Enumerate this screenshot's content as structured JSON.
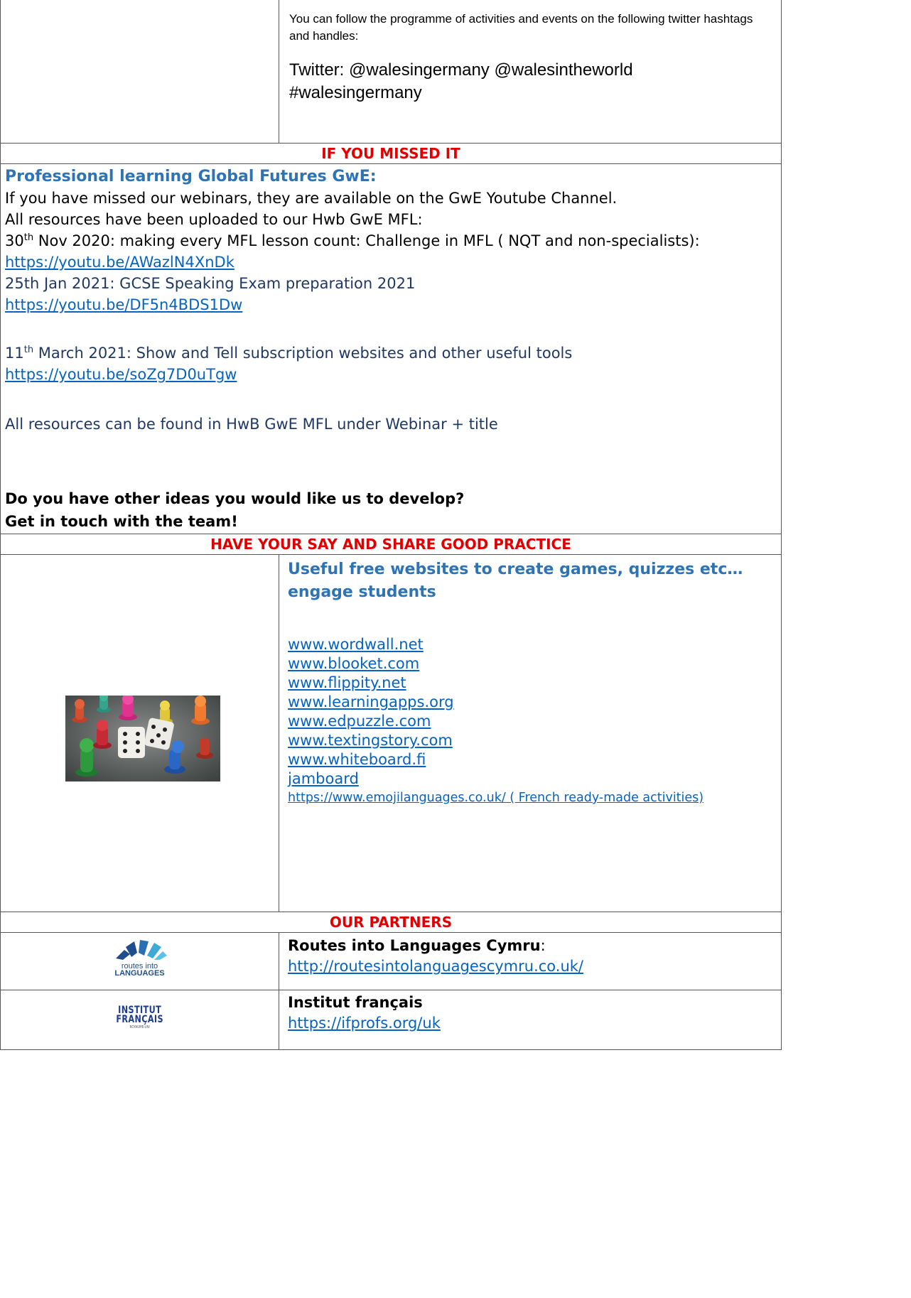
{
  "twitter_block": {
    "intro": "You can follow the programme of activities and events on the following twitter hashtags and handles:",
    "handles_line1": "Twitter: @walesingermany @walesintheworld",
    "handles_line2": "#walesingermany"
  },
  "missed_section": {
    "header": "IF YOU MISSED IT",
    "title": "Professional learning Global Futures GwE:",
    "line1": "If you have missed our webinars, they are available on the GwE Youtube Channel.",
    "line2": "All resources have been uploaded to our Hwb GwE MFL:",
    "webinar1_day": "30",
    "webinar1_sup": "th",
    "webinar1_text": " Nov 2020: making every MFL lesson count: Challenge in MFL  ( NQT and non-specialists): ",
    "webinar1_link": "https://youtu.be/AWazlN4XnDk",
    "webinar2_text": "25th Jan 2021: GCSE Speaking Exam preparation 2021",
    "webinar2_link": "https://youtu.be/DF5n4BDS1Dw",
    "webinar3_day": "11",
    "webinar3_sup": "th",
    "webinar3_text": " March 2021: Show and Tell subscription websites and other useful tools",
    "webinar3_link": "https://youtu.be/soZg7D0uTgw",
    "resources_note": "All resources can be found in HwB GwE MFL under Webinar + title",
    "question": "Do you have other ideas you would like us to develop?",
    "cta": "Get in touch with the team!"
  },
  "share_section": {
    "header": "HAVE YOUR SAY AND SHARE GOOD PRACTICE",
    "title": "Useful free websites to create games, quizzes etc…engage students",
    "links": [
      "www.wordwall.net",
      "www.blooket.com",
      "www.flippity.net",
      "www.learningapps.org",
      "www.edpuzzle.com",
      "www.textingstory.com",
      "www.whiteboard.fi",
      "jamboard"
    ],
    "emoji_link": "https://www.emojilanguages.co.uk/ ( French ready-made activities)"
  },
  "partners_section": {
    "header": "OUR PARTNERS",
    "routes": {
      "name": "Routes into Languages Cymru",
      "colon": ":",
      "link": "http://routesintolanguagescymru.co.uk/",
      "logo_line1": "routes into",
      "logo_line2": "LANGUAGES"
    },
    "institut": {
      "name": "Institut français",
      "link": "https://ifprofs.org/uk",
      "logo_line1": "INSTITUT",
      "logo_line2": "FRANÇAIS",
      "logo_line3": "ROYAUME-UNI"
    }
  },
  "colors": {
    "header_red": "#e00000",
    "title_blue": "#2e74b5",
    "link_blue": "#0563c1",
    "navy_text": "#1f3864",
    "routes_blue": "#1e4f8c",
    "routes_light": "#3fa9d6"
  }
}
